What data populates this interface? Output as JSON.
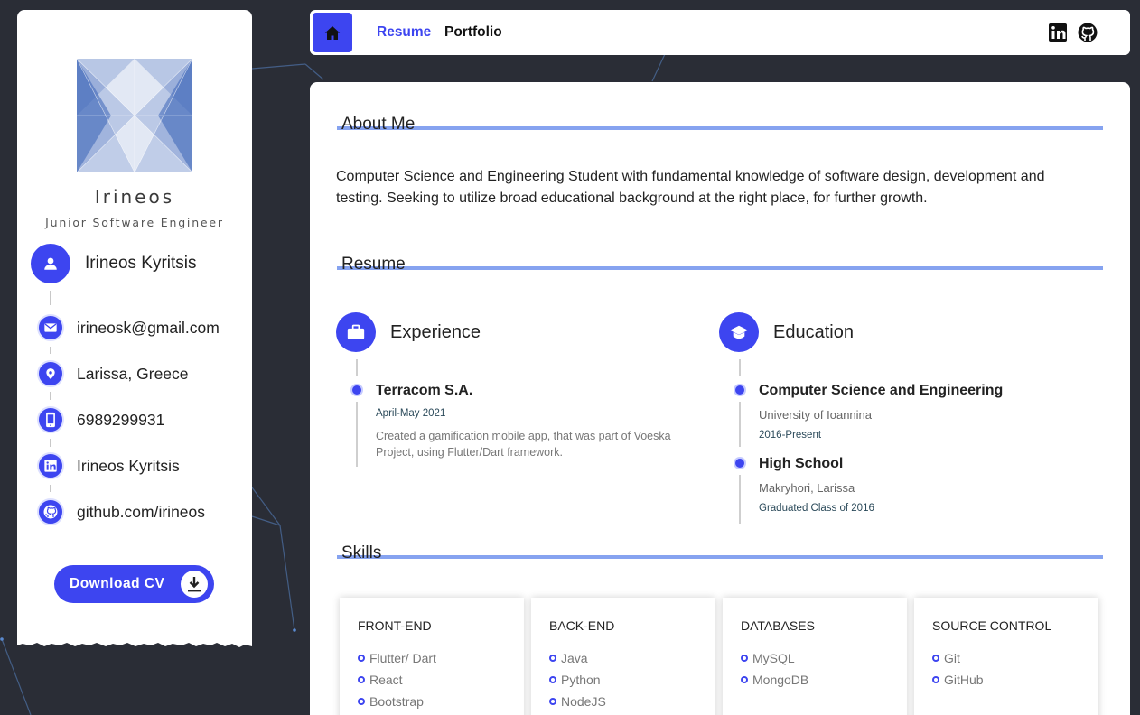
{
  "sidebar": {
    "brand_name": "Irineos",
    "brand_subtitle": "Junior Software Engineer",
    "profile_name": "Irineos Kyritsis",
    "contacts": [
      {
        "icon": "email-icon",
        "text": "irineosk@gmail.com"
      },
      {
        "icon": "location-icon",
        "text": "Larissa, Greece"
      },
      {
        "icon": "phone-icon",
        "text": "6989299931"
      },
      {
        "icon": "linkedin-icon",
        "text": "Irineos Kyritsis"
      },
      {
        "icon": "github-icon",
        "text": "github.com/irineos"
      }
    ],
    "download_label": "Download CV"
  },
  "nav": {
    "home_icon": "home-icon",
    "links": [
      "Resume",
      "Portfolio"
    ],
    "social": [
      "linkedin-icon",
      "github-icon"
    ]
  },
  "about": {
    "title": "About Me",
    "text": "Computer Science and Engineering Student with fundamental knowledge of software design, development and testing. Seeking to utilize broad educational background at the right place, for further growth."
  },
  "resume": {
    "title": "Resume",
    "experience": {
      "title": "Experience",
      "items": [
        {
          "title": "Terracom S.A.",
          "date": "April-May 2021",
          "desc": "Created a gamification mobile app, that was part of Voeska Project, using Flutter/Dart framework."
        }
      ]
    },
    "education": {
      "title": "Education",
      "items": [
        {
          "title": "Computer Science and Engineering",
          "sub": "University of Ioannina",
          "date": "2016-Present"
        },
        {
          "title": "High School",
          "sub": "Makryhori, Larissa",
          "date": "Graduated Class of 2016"
        }
      ]
    }
  },
  "skills": {
    "title": "Skills",
    "categories": [
      {
        "name": "FRONT-END",
        "items": [
          "Flutter/ Dart",
          "React",
          "Bootstrap"
        ]
      },
      {
        "name": "BACK-END",
        "items": [
          "Java",
          "Python",
          "NodeJS"
        ]
      },
      {
        "name": "DATABASES",
        "items": [
          "MySQL",
          "MongoDB"
        ]
      },
      {
        "name": "SOURCE CONTROL",
        "items": [
          "Git",
          "GitHub"
        ]
      }
    ]
  },
  "colors": {
    "accent": "#3d45f0",
    "section_bar": "#86a3f0",
    "background": "#2a2d36"
  }
}
